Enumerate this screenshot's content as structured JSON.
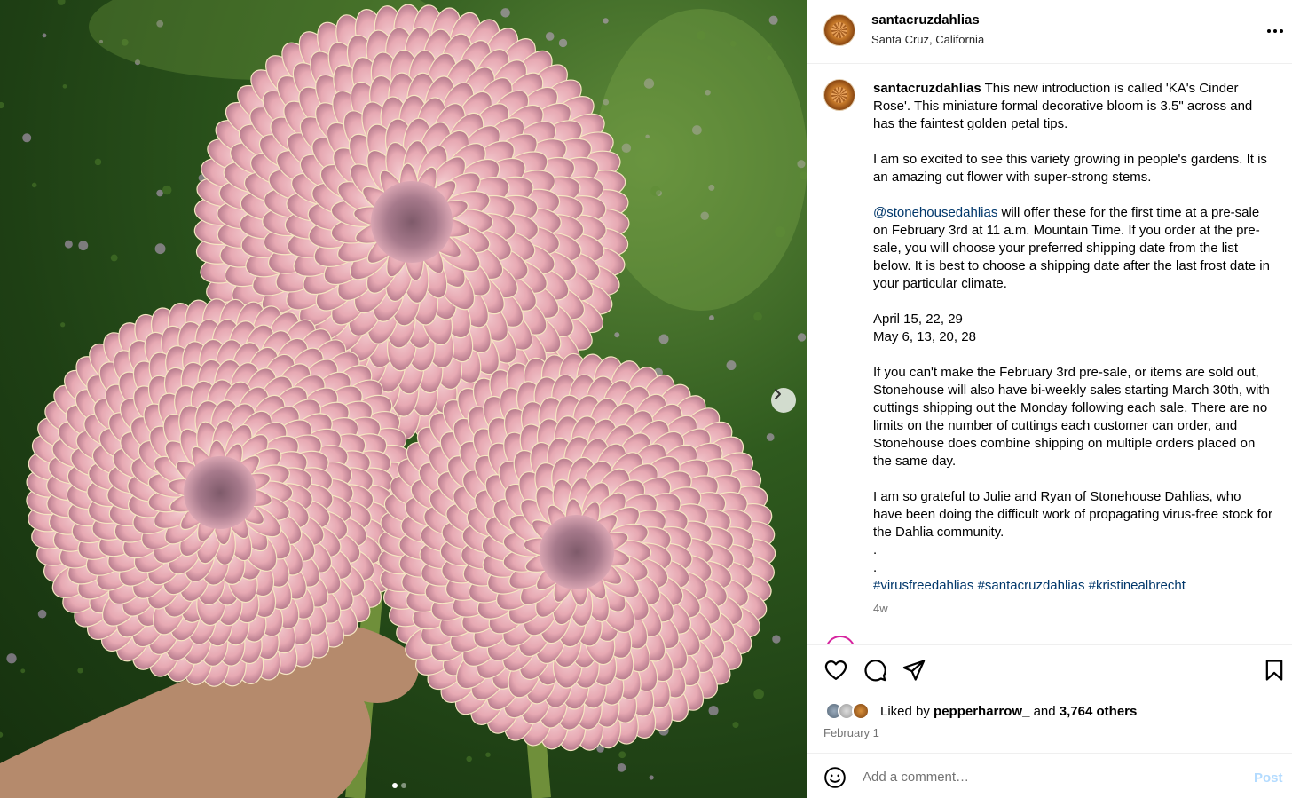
{
  "post": {
    "username": "santacruzdahlias",
    "location": "Santa Cruz, California",
    "more_icon": "more-horizontal-icon",
    "carousel": {
      "current_slide": 1,
      "total_slides": 2,
      "next_icon": "chevron-right-icon"
    }
  },
  "caption": {
    "username": "santacruzdahlias",
    "p1": "This new introduction is called 'KA's Cinder Rose'. This miniature formal decorative bloom is 3.5\" across and has the faintest golden petal tips.",
    "p2": "I am so excited to see this variety growing in people's gardens. It is an amazing cut flower with super-strong stems.",
    "p3_mention": "@stonehousedahlias",
    "p3_rest": " will offer these for the first time at a pre-sale on February 3rd at 11 a.m. Mountain Time. If you order at the pre-sale, you will choose your preferred shipping date from the list below. It is best to choose a shipping date after the last frost date in your particular climate.",
    "dates_line1": "April 15, 22, 29",
    "dates_line2": "May 6, 13, 20, 28",
    "p5": "If you can't make the February 3rd pre-sale, or items are sold out, Stonehouse will also have bi-weekly sales starting March 30th, with cuttings shipping out the Monday following each sale. There are no limits on the number of cuttings each customer can order, and Stonehouse does combine shipping on multiple orders placed on the same day.",
    "p6": "I am so grateful to Julie and Ryan of Stonehouse Dahlias, who have been doing the difficult work of propagating virus-free stock for the Dahlia community.",
    "dot1": ".",
    "dot2": ".",
    "hashtag1": "#virusfreedahlias",
    "hashtag2": "#santacruzdahlias",
    "hashtag3": "#kristinealbrecht",
    "time_ago": "4w"
  },
  "actions": {
    "like_icon": "heart-icon",
    "comment_icon": "comment-bubble-icon",
    "share_icon": "paper-plane-icon",
    "save_icon": "bookmark-icon"
  },
  "likes": {
    "prefix": "Liked by ",
    "user": "pepperharrow_",
    "mid": " and ",
    "others": "3,764 others"
  },
  "date": "February 1",
  "comment_box": {
    "emoji_icon": "smiley-icon",
    "placeholder": "Add a comment…",
    "post_label": "Post"
  }
}
